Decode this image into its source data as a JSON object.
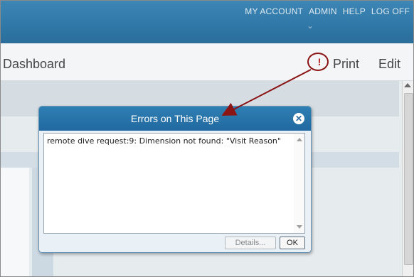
{
  "header": {
    "links": [
      "MY ACCOUNT",
      "ADMIN",
      "HELP",
      "LOG OFF"
    ]
  },
  "toolbar": {
    "title": "Dashboard",
    "print_label": "Print",
    "edit_label": "Edit",
    "alert_glyph": "!"
  },
  "dialog": {
    "title": "Errors on This Page",
    "close_glyph": "✕",
    "message": "remote dive request:9: Dimension not found: \"Visit Reason\"",
    "details_label": "Details...",
    "ok_label": "OK"
  },
  "colors": {
    "header_blue": "#2f77a6",
    "annotation_red": "#8b1414"
  }
}
